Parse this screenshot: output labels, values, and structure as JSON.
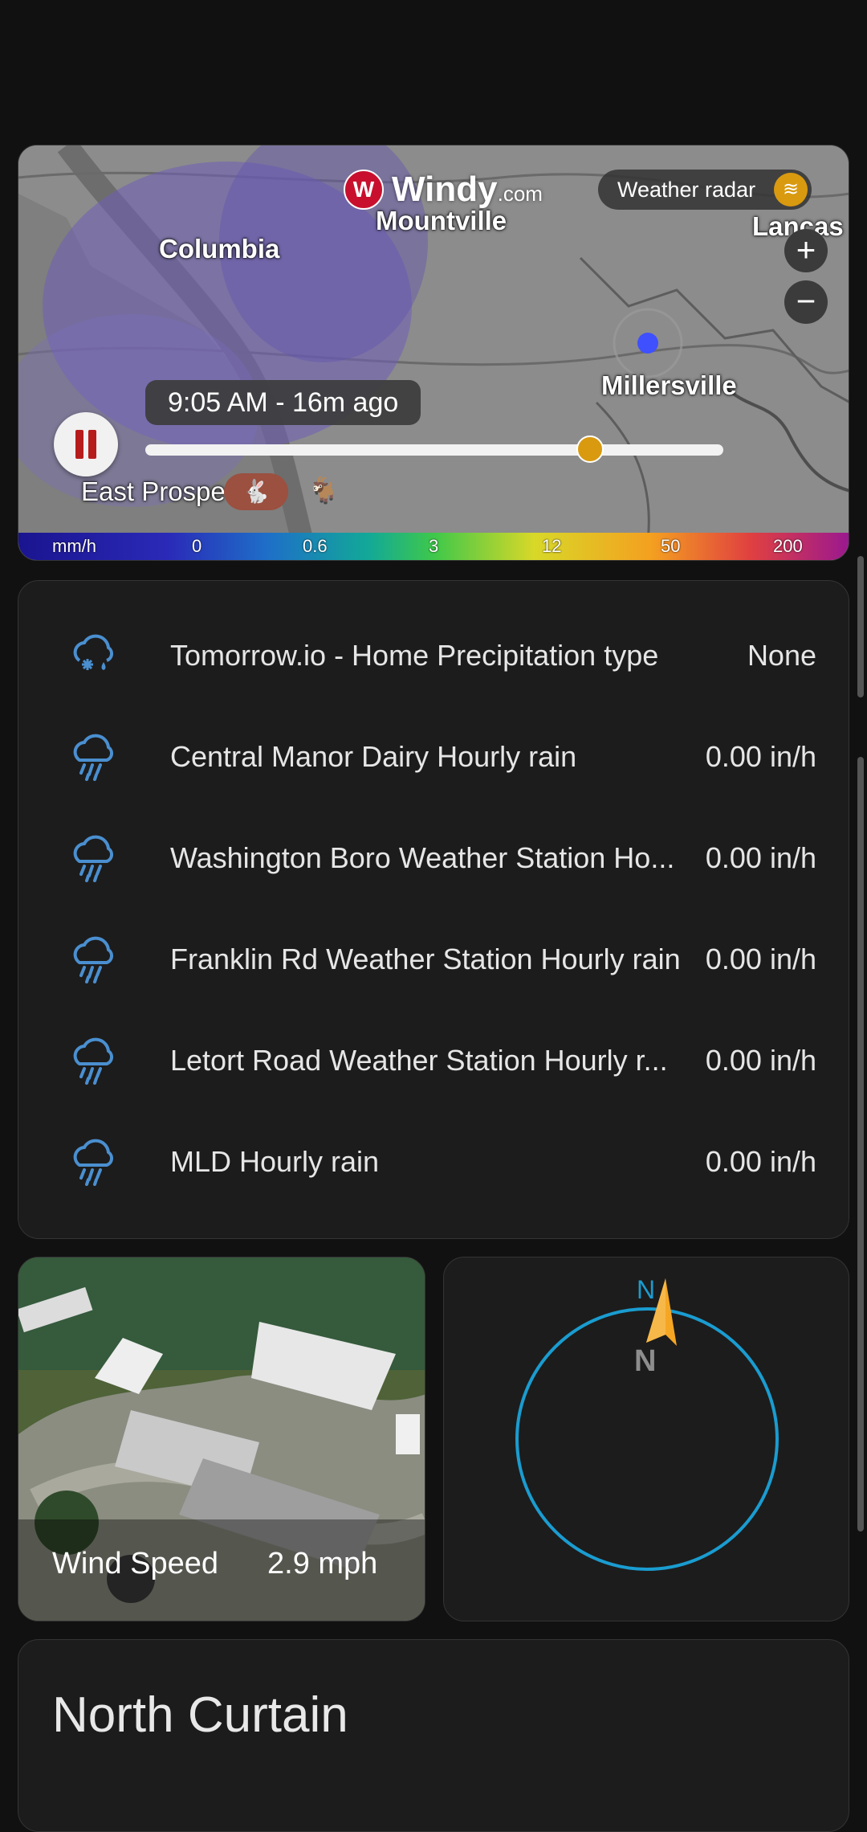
{
  "map": {
    "brand": "Windy",
    "brand_suffix": ".com",
    "layer_label": "Weather radar",
    "cities": [
      "Columbia",
      "Mountville",
      "Lancas",
      "Millersville",
      "East Prospe"
    ],
    "time_label": "9:05 AM - 16m ago",
    "timeline_progress": 0.77,
    "zoom_in": "+",
    "zoom_out": "−",
    "scale": [
      "mm/h",
      "0",
      "0.6",
      "3",
      "12",
      "50",
      "200"
    ]
  },
  "sensors": [
    {
      "icon": "snow-rain-icon",
      "name": "Tomorrow.io - Home Precipitation type",
      "value": "None"
    },
    {
      "icon": "rain-icon",
      "name": "Central Manor Dairy Hourly rain",
      "value": "0.00 in/h"
    },
    {
      "icon": "rain-icon",
      "name": "Washington Boro Weather Station Ho...",
      "value": "0.00 in/h"
    },
    {
      "icon": "rain-icon",
      "name": "Franklin Rd Weather Station Hourly rain",
      "value": "0.00 in/h"
    },
    {
      "icon": "rain-icon",
      "name": "Letort Road Weather Station Hourly r...",
      "value": "0.00 in/h"
    },
    {
      "icon": "rain-icon",
      "name": "MLD Hourly rain",
      "value": "0.00 in/h"
    }
  ],
  "wind_tile": {
    "label": "Wind Speed",
    "value": "2.9 mph"
  },
  "compass": {
    "top_label": "N",
    "center_label": "N",
    "heading_deg": 0
  },
  "section_title": "North Curtain",
  "colors": {
    "accent_blue": "#1a9cd0",
    "rain_icon": "#4a8fd0",
    "arrow": "#f5a623",
    "thumb": "#d99a10"
  }
}
